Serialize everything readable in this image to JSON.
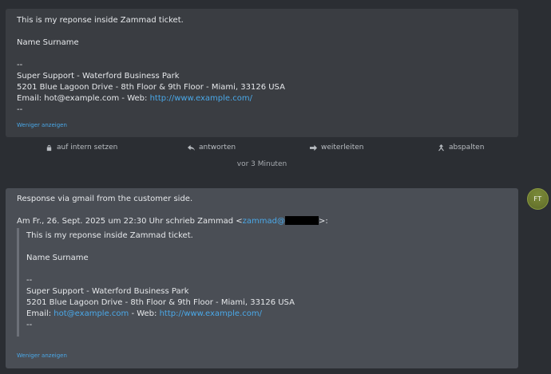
{
  "message1": {
    "lines": [
      "This is my reponse inside Zammad ticket.",
      "Name Surname",
      "--",
      "Super Support - Waterford Business Park",
      "5201 Blue Lagoon Drive - 8th Floor & 9th Floor - Miami, 33126 USA"
    ],
    "email_label": "Email: hot@example.com - Web: ",
    "web_link": "http://www.example.com/",
    "trailer": "--",
    "less_link": "Weniger anzeigen"
  },
  "actions": {
    "internal": "auf intern setzen",
    "reply": "antworten",
    "forward": "weiterleiten",
    "split": "abspalten"
  },
  "timestamp": "vor 3 Minuten",
  "message2": {
    "body": "Response via gmail from the customer side.",
    "quote_header_prefix": "Am Fr., 26. Sept. 2025 um 22:30 Uhr schrieb Zammad <",
    "quote_header_email": "zammad@",
    "quote_header_suffix": ">:",
    "quote": {
      "line1": "This is my reponse inside Zammad ticket.",
      "line2": "Name Surname",
      "line3": "--",
      "line4": "Super Support - Waterford Business Park",
      "line5": "5201 Blue Lagoon Drive - 8th Floor & 9th Floor - Miami, 33126 USA",
      "email_prefix": "Email: ",
      "email_link": "hot@example.com",
      "web_prefix": " - Web: ",
      "web_link": "http://www.example.com/",
      "trailer": "--"
    },
    "less_link": "Weniger anzeigen"
  },
  "avatar": {
    "initials": "FT"
  },
  "colors": {
    "link": "#4aa8e8",
    "bubble_agent": "#3a3d42",
    "bubble_customer": "#4a4e55",
    "avatar": "#6d7a30"
  }
}
